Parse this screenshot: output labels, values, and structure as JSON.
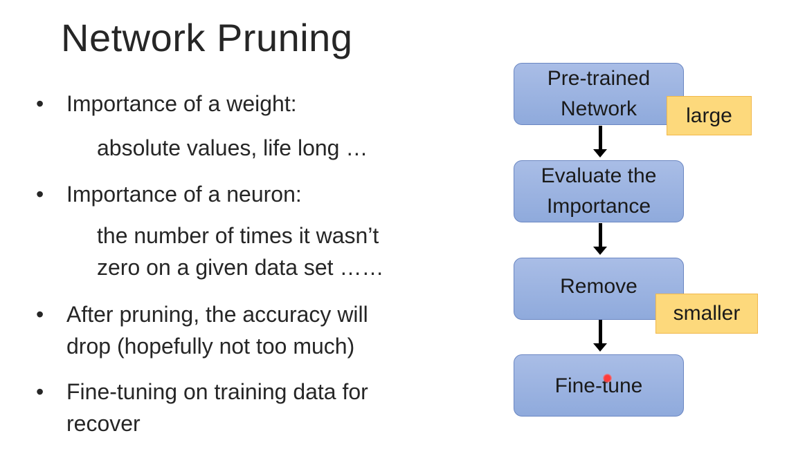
{
  "slide": {
    "title": "Network Pruning",
    "bullets": [
      {
        "marker": "•",
        "text": "Importance of a weight:",
        "sub": [
          "absolute values, life long …"
        ]
      },
      {
        "marker": "•",
        "text": "Importance of a neuron:",
        "sub": [
          "the number of times it wasn’t",
          "zero on a given data set ……"
        ]
      },
      {
        "marker": "•",
        "lines": [
          "After pruning, the accuracy will",
          "drop (hopefully not too much)"
        ]
      },
      {
        "marker": "•",
        "lines": [
          "Fine-tuning on training data for",
          "recover"
        ]
      }
    ]
  },
  "flowchart": {
    "steps": [
      {
        "lines": [
          "Pre-trained",
          "Network"
        ]
      },
      {
        "lines": [
          "Evaluate the",
          "Importance"
        ]
      },
      {
        "lines": [
          "Remove"
        ]
      },
      {
        "lines": [
          "Fine-tune"
        ]
      }
    ],
    "tags": {
      "large": "large",
      "smaller": "smaller"
    },
    "colors": {
      "box": "#8faadc",
      "box_border": "#6a86c2",
      "tag": "#fdd97c",
      "tag_border": "#f1b74a",
      "arrow": "#000000"
    }
  }
}
